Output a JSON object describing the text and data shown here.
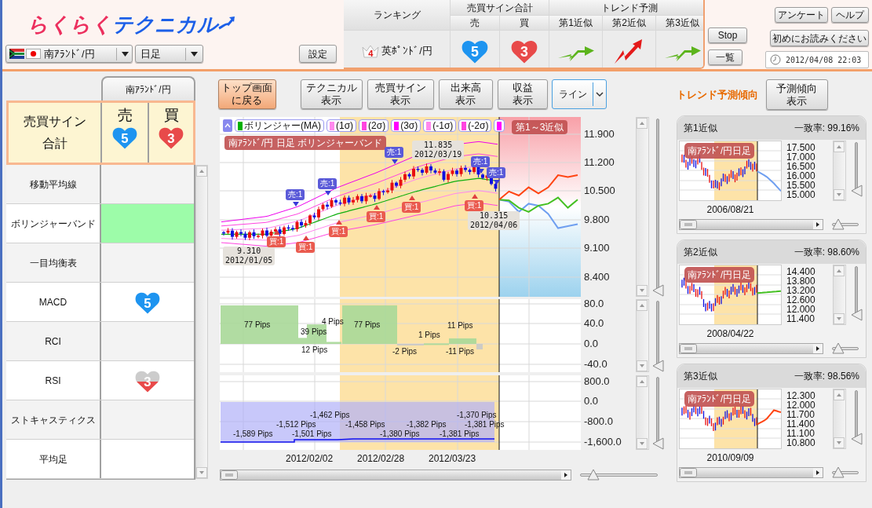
{
  "header": {
    "logo": {
      "words": [
        "らくらく",
        "テクニカル"
      ]
    },
    "currency_select": {
      "value": "南ｱﾗﾝﾄﾞ/円"
    },
    "period_select": {
      "value": "日足"
    },
    "settings_button": "設定",
    "ranking": {
      "rank_heading": "ランキング",
      "signal_heading": "売買サイン合計",
      "sell_heading": "売",
      "buy_heading": "買",
      "trend_heading": "トレンド予測",
      "trend_columns": [
        "第1近似",
        "第2近似",
        "第3近似"
      ],
      "row": {
        "rank": "4",
        "pair": "英ﾎﾟﾝﾄﾞ/円",
        "sell": {
          "kind": "sell",
          "count": "5"
        },
        "buy": {
          "kind": "buy",
          "count": "3"
        },
        "trends": [
          {
            "kind": "up_right"
          },
          {
            "kind": "up"
          },
          {
            "kind": "up_right"
          }
        ]
      }
    },
    "stop_button": "Stop",
    "list_button": "一覧",
    "survey_button": "アンケート",
    "help_button": "ヘルプ",
    "readme_button": "初めにお読みください",
    "datetime": "2012/04/08 22:03"
  },
  "signal_panel": {
    "tab": "南ｱﾗﾝﾄﾞ/円",
    "summary": {
      "label": "売買サイン合計",
      "sell_heading": "売",
      "buy_heading": "買",
      "sell": {
        "kind": "sell",
        "count": "5"
      },
      "buy": {
        "kind": "buy",
        "count": "3"
      }
    },
    "indicators": [
      {
        "label": "移動平均線",
        "selected": false
      },
      {
        "label": "ボリンジャーバンド",
        "selected": true
      },
      {
        "label": "一目均衡表",
        "selected": false
      },
      {
        "label": "MACD",
        "selected": false,
        "signal": {
          "kind": "sell",
          "count": "5"
        }
      },
      {
        "label": "RCI",
        "selected": false
      },
      {
        "label": "RSI",
        "selected": false,
        "signal": {
          "kind": "buy",
          "count": "3",
          "level": 0.5
        }
      },
      {
        "label": "ストキャスティクス",
        "selected": false
      },
      {
        "label": "平均足",
        "selected": false
      }
    ]
  },
  "toolbar": {
    "buttons": [
      {
        "label": "トップ画面に戻る",
        "kind": "primary"
      },
      {
        "label": "テクニカル表示",
        "kind": "normal"
      },
      {
        "label": "売買サイン表示",
        "kind": "normal"
      },
      {
        "label": "出来高表示",
        "kind": "normal"
      },
      {
        "label": "収益表示",
        "kind": "normal"
      }
    ],
    "chart_type": {
      "value": "ライン"
    }
  },
  "price_chart": {
    "legend": [
      {
        "label": "ボリンジャー(MA)",
        "color": "#00b000"
      },
      {
        "label": "(1σ)",
        "color": "#ff88ee"
      },
      {
        "label": "(2σ)",
        "color": "#ff44e0"
      },
      {
        "label": "(3σ)",
        "color": "#ff00ff"
      },
      {
        "label": "(-1σ)",
        "color": "#ff88ee"
      },
      {
        "label": "(-2σ)",
        "color": "#ff44e0"
      },
      {
        "color": "#ff00ff"
      }
    ],
    "title_tag": "南ｱﾗﾝﾄﾞ/円 日足 ボリンジャーバンド",
    "forecast_tag": "第1～3近似",
    "y_ticks": [
      "11.900",
      "11.200",
      "10.500",
      "9.800",
      "9.100",
      "8.400"
    ],
    "signals": [
      {
        "kind": "sell",
        "label": "売:1"
      },
      {
        "kind": "sell",
        "label": "売:1"
      },
      {
        "kind": "sell",
        "label": "売:1"
      },
      {
        "kind": "sell",
        "label": "売:1"
      },
      {
        "kind": "sell",
        "label": "売:1"
      },
      {
        "kind": "buy",
        "label": "買:1"
      },
      {
        "kind": "buy",
        "label": "買:1"
      },
      {
        "kind": "buy",
        "label": "買:1"
      },
      {
        "kind": "buy",
        "label": "買:1"
      },
      {
        "kind": "buy",
        "label": "買:1"
      },
      {
        "kind": "buy",
        "label": "買:1"
      }
    ],
    "price_notes": [
      {
        "value": "9.310",
        "date": "2012/01/05"
      },
      {
        "value": "11.835",
        "date": "2012/03/19"
      },
      {
        "value": "10.315",
        "date": "2012/04/06"
      }
    ],
    "zoom_slider": {
      "level": 0
    }
  },
  "profit_chart": {
    "y_ticks": [
      "80.0",
      "40.0",
      "0.0",
      "-40.0"
    ],
    "labels": [
      "77 Pips",
      "4 Pips",
      "39 Pips",
      "12 Pips",
      "77 Pips",
      "-2 Pips",
      "1 Pips",
      "11 Pips",
      "-11 Pips"
    ],
    "zoom_slider": {
      "level": 0
    }
  },
  "cumulative_chart": {
    "y_ticks": [
      "800.0",
      "0.0",
      "-800.0",
      "-1,600.0"
    ],
    "labels": [
      "-1,462 Pips",
      "-1,370 Pips",
      "-1,512 Pips",
      "-1,458 Pips",
      "-1,382 Pips",
      "-1,381 Pips",
      "-1,589 Pips",
      "-1,501 Pips",
      "-1,380 Pips",
      "-1,381 Pips"
    ],
    "zoom_slider": {
      "level": 0
    }
  },
  "x_dates": [
    "2012/02/02",
    "2012/02/28",
    "2012/03/23"
  ],
  "h_zoom_slider": {
    "level": 0.12
  },
  "trend_panel": {
    "title": "トレンド予測傾向",
    "button": "予測傾向表示",
    "cards": [
      {
        "title": "第1近似",
        "match": "一致率: 99.16%",
        "color": "#6f9ff0",
        "tag": "南ｱﾗﾝﾄﾞ/円日足",
        "y_ticks": [
          "17.500",
          "17.000",
          "16.500",
          "16.000",
          "15.500",
          "15.000"
        ],
        "date": "2006/08/21",
        "zoom_slider": {
          "level": 0
        },
        "h_zoom_slider": {
          "level": 0.05
        }
      },
      {
        "title": "第2近似",
        "match": "一致率: 98.60%",
        "color": "#44c022",
        "tag": "南ｱﾗﾝﾄﾞ/円日足",
        "y_ticks": [
          "14.400",
          "13.800",
          "13.200",
          "12.600",
          "12.000",
          "11.400"
        ],
        "date": "2008/04/22",
        "zoom_slider": {
          "level": 0
        },
        "h_zoom_slider": {
          "level": 0.05
        }
      },
      {
        "title": "第3近似",
        "match": "一致率: 98.56%",
        "color": "#ff4412",
        "tag": "南ｱﾗﾝﾄﾞ/円日足",
        "y_ticks": [
          "12.300",
          "12.000",
          "11.700",
          "11.400",
          "11.100",
          "10.800"
        ],
        "date": "2010/09/09",
        "zoom_slider": {
          "level": 0
        },
        "h_zoom_slider": {
          "level": 0.05
        }
      }
    ]
  }
}
